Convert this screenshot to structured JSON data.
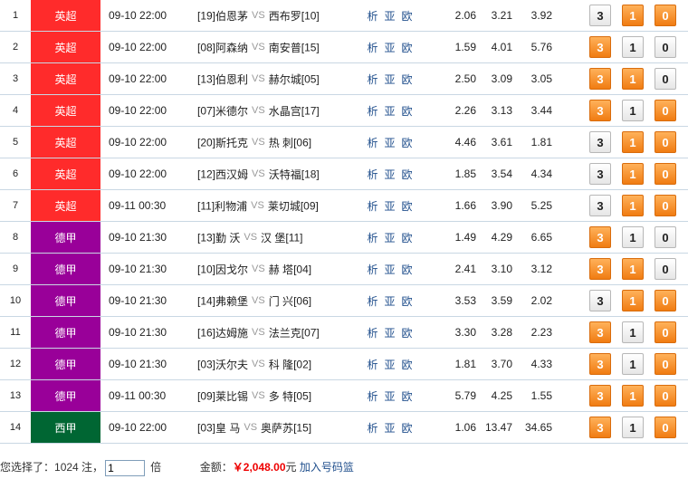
{
  "colors": {
    "英超": "#ff2b2b",
    "德甲": "#990099",
    "西甲": "#006633",
    "btn_on": "#f07c12",
    "btn_off": "#eeeeee"
  },
  "vs_label": "VS",
  "links": [
    "析",
    "亚",
    "欧"
  ],
  "matches": [
    {
      "idx": "1",
      "league": "英超",
      "time": "09-10 22:00",
      "home_rank": "[19]",
      "home": "伯恩茅",
      "away": "西布罗",
      "away_rank": "[10]",
      "odds": [
        "2.06",
        "3.21",
        "3.92"
      ],
      "bets": [
        {
          "label": "3",
          "selected": false
        },
        {
          "label": "1",
          "selected": true
        },
        {
          "label": "0",
          "selected": true
        }
      ]
    },
    {
      "idx": "2",
      "league": "英超",
      "time": "09-10 22:00",
      "home_rank": "[08]",
      "home": "阿森纳",
      "away": "南安普",
      "away_rank": "[15]",
      "odds": [
        "1.59",
        "4.01",
        "5.76"
      ],
      "bets": [
        {
          "label": "3",
          "selected": true
        },
        {
          "label": "1",
          "selected": false
        },
        {
          "label": "0",
          "selected": false
        }
      ]
    },
    {
      "idx": "3",
      "league": "英超",
      "time": "09-10 22:00",
      "home_rank": "[13]",
      "home": "伯恩利",
      "away": "赫尔城",
      "away_rank": "[05]",
      "odds": [
        "2.50",
        "3.09",
        "3.05"
      ],
      "bets": [
        {
          "label": "3",
          "selected": true
        },
        {
          "label": "1",
          "selected": true
        },
        {
          "label": "0",
          "selected": false
        }
      ]
    },
    {
      "idx": "4",
      "league": "英超",
      "time": "09-10 22:00",
      "home_rank": "[07]",
      "home": "米德尔",
      "away": "水晶宫",
      "away_rank": "[17]",
      "odds": [
        "2.26",
        "3.13",
        "3.44"
      ],
      "bets": [
        {
          "label": "3",
          "selected": true
        },
        {
          "label": "1",
          "selected": false
        },
        {
          "label": "0",
          "selected": true
        }
      ]
    },
    {
      "idx": "5",
      "league": "英超",
      "time": "09-10 22:00",
      "home_rank": "[20]",
      "home": "斯托克",
      "away": "热 刺",
      "away_rank": "[06]",
      "odds": [
        "4.46",
        "3.61",
        "1.81"
      ],
      "bets": [
        {
          "label": "3",
          "selected": false
        },
        {
          "label": "1",
          "selected": true
        },
        {
          "label": "0",
          "selected": true
        }
      ]
    },
    {
      "idx": "6",
      "league": "英超",
      "time": "09-10 22:00",
      "home_rank": "[12]",
      "home": "西汉姆",
      "away": "沃特福",
      "away_rank": "[18]",
      "odds": [
        "1.85",
        "3.54",
        "4.34"
      ],
      "bets": [
        {
          "label": "3",
          "selected": false
        },
        {
          "label": "1",
          "selected": true
        },
        {
          "label": "0",
          "selected": true
        }
      ]
    },
    {
      "idx": "7",
      "league": "英超",
      "time": "09-11 00:30",
      "home_rank": "[11]",
      "home": "利物浦",
      "away": "莱切城",
      "away_rank": "[09]",
      "odds": [
        "1.66",
        "3.90",
        "5.25"
      ],
      "bets": [
        {
          "label": "3",
          "selected": false
        },
        {
          "label": "1",
          "selected": true
        },
        {
          "label": "0",
          "selected": true
        }
      ]
    },
    {
      "idx": "8",
      "league": "德甲",
      "time": "09-10 21:30",
      "home_rank": "[13]",
      "home": "勤 沃",
      "away": "汉 堡",
      "away_rank": "[11]",
      "odds": [
        "1.49",
        "4.29",
        "6.65"
      ],
      "bets": [
        {
          "label": "3",
          "selected": true
        },
        {
          "label": "1",
          "selected": false
        },
        {
          "label": "0",
          "selected": false
        }
      ]
    },
    {
      "idx": "9",
      "league": "德甲",
      "time": "09-10 21:30",
      "home_rank": "[10]",
      "home": "因戈尔",
      "away": "赫 塔",
      "away_rank": "[04]",
      "odds": [
        "2.41",
        "3.10",
        "3.12"
      ],
      "bets": [
        {
          "label": "3",
          "selected": true
        },
        {
          "label": "1",
          "selected": true
        },
        {
          "label": "0",
          "selected": false
        }
      ]
    },
    {
      "idx": "10",
      "league": "德甲",
      "time": "09-10 21:30",
      "home_rank": "[14]",
      "home": "弗赖堡",
      "away": "门 兴",
      "away_rank": "[06]",
      "odds": [
        "3.53",
        "3.59",
        "2.02"
      ],
      "bets": [
        {
          "label": "3",
          "selected": false
        },
        {
          "label": "1",
          "selected": true
        },
        {
          "label": "0",
          "selected": true
        }
      ]
    },
    {
      "idx": "11",
      "league": "德甲",
      "time": "09-10 21:30",
      "home_rank": "[16]",
      "home": "达姆施",
      "away": "法兰克",
      "away_rank": "[07]",
      "odds": [
        "3.30",
        "3.28",
        "2.23"
      ],
      "bets": [
        {
          "label": "3",
          "selected": true
        },
        {
          "label": "1",
          "selected": false
        },
        {
          "label": "0",
          "selected": true
        }
      ]
    },
    {
      "idx": "12",
      "league": "德甲",
      "time": "09-10 21:30",
      "home_rank": "[03]",
      "home": "沃尔夫",
      "away": "科 隆",
      "away_rank": "[02]",
      "odds": [
        "1.81",
        "3.70",
        "4.33"
      ],
      "bets": [
        {
          "label": "3",
          "selected": true
        },
        {
          "label": "1",
          "selected": false
        },
        {
          "label": "0",
          "selected": true
        }
      ]
    },
    {
      "idx": "13",
      "league": "德甲",
      "time": "09-11 00:30",
      "home_rank": "[09]",
      "home": "莱比锡",
      "away": "多 特",
      "away_rank": "[05]",
      "odds": [
        "5.79",
        "4.25",
        "1.55"
      ],
      "bets": [
        {
          "label": "3",
          "selected": true
        },
        {
          "label": "1",
          "selected": true
        },
        {
          "label": "0",
          "selected": true
        }
      ]
    },
    {
      "idx": "14",
      "league": "西甲",
      "time": "09-10 22:00",
      "home_rank": "[03]",
      "home": "皇 马",
      "away": "奥萨苏",
      "away_rank": "[15]",
      "odds": [
        "1.06",
        "13.47",
        "34.65"
      ],
      "bets": [
        {
          "label": "3",
          "selected": true
        },
        {
          "label": "1",
          "selected": false
        },
        {
          "label": "0",
          "selected": true
        }
      ]
    }
  ],
  "footer": {
    "selected_prefix": "您选择了：",
    "selected_count": "1024",
    "selected_suffix": " 注，",
    "multiple_value": "1",
    "multiple_unit": "倍",
    "amount_label": "金额：",
    "amount_value": "￥2,048.00",
    "amount_unit": "元",
    "add_link": "加入号码篮"
  }
}
